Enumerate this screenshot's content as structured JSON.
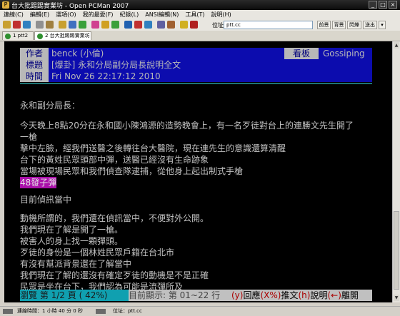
{
  "window": {
    "title": "台大批踢踢實業坊 - Open PCMan 2007"
  },
  "menu": [
    "連線(C)",
    "編輯(E)",
    "選項(O)",
    "我的最愛(F)",
    "紀錄(L)",
    "ANSI編輯(N)",
    "工具(T)",
    "說明(H)"
  ],
  "toolbar": {
    "address_label": "位址：",
    "address_value": "ptt.cc",
    "buttons": [
      "前景",
      "背景",
      "閃爍",
      "送出"
    ],
    "icon_names": [
      "new-connection-icon",
      "disconnect-icon",
      "reconnect-icon",
      "copy-icon",
      "paste-icon",
      "quick-connect-icon",
      "address-book-icon",
      "settings-icon",
      "color-icon",
      "anti-idle-icon",
      "download-icon",
      "font-icon",
      "ansi-icon",
      "open-icon",
      "save-icon",
      "edit-icon",
      "emoticon-icon",
      "exit-icon"
    ]
  },
  "tabs": [
    {
      "label": "1 ptt2"
    },
    {
      "label": "2 台大批踢踢實業坊"
    }
  ],
  "article": {
    "author_key": "作者",
    "author_val": "benck (小倫)",
    "board_key": "看板",
    "board_val": "Gossiping",
    "title_key": "標題",
    "title_val": "[爆卦] 永和分局副分局長說明全文",
    "time_key": "時間",
    "time_val": "Fri Nov 26 22:17:12 2010",
    "lines": [
      "永和副分局長：",
      "",
      "今天晚上8點20分在永和國小陳鴻源的造勢晚會上，有一名歹徒對台上的連勝文先生開了",
      "一槍",
      "擊中左臉，經我們送醫之後轉往台大醫院，現在連先生的意識還算清醒",
      "台下的黃姓民眾頭部中彈，送醫已經沒有生命跡象",
      "當場被現場民眾和我們偵查隊逮捕，從他身上起出制式手槍",
      "48發子彈",
      "",
      "目前偵訊當中",
      "",
      "動機所謂的，我們還在偵訊當中，不便對外公開。",
      "我們現在了解是開了一槍。",
      "被害人的身上找一顆彈頭。",
      "歹徒的身份是一個林姓民眾戶籍在台北市",
      "有沒有幫派背景還在了解當中",
      "我們現在了解的還沒有確定歹徒的動機是不是正確",
      "民眾是坐在台下，我們認為可能是流彈所及"
    ]
  },
  "pager": {
    "browse": "  瀏覽 第 1/2 頁 ( 42%) ",
    "range": " 目前顯示: 第 01~22 行  ",
    "r1": "(y)",
    "r2": "回應",
    "r3": "(X%)",
    "r4": "推文",
    "r5": "(h)",
    "r6": "說明",
    "r7": "(←)",
    "r8": "離開"
  },
  "statusbar": {
    "connection_time": "連線時間：1 小時 40 分 0 秒",
    "address": "位址：ptt.cc"
  }
}
